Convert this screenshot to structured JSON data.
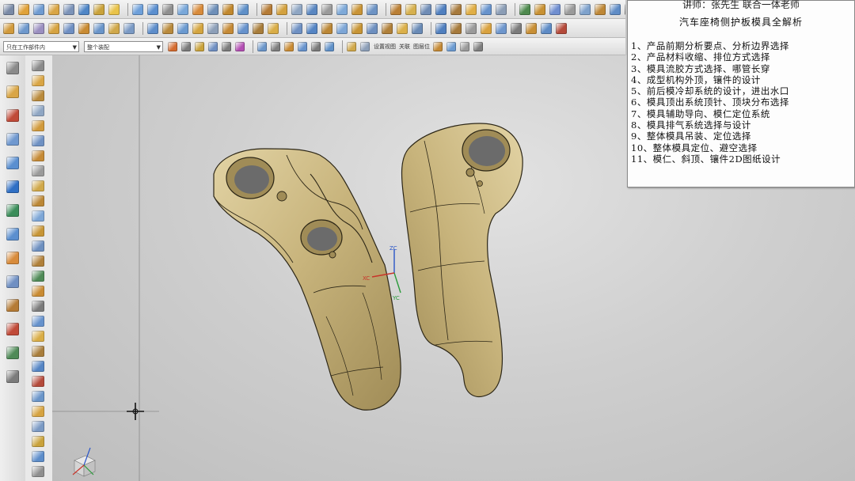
{
  "toolbar": {
    "row1_icon_colors": [
      "#7a8aa6",
      "#e0a23a",
      "#6f9bd1",
      "#d9a545",
      "#7c93b8",
      "#4f86c6",
      "#c9a23b",
      "#e9c34a",
      "#6ea0da",
      "#5b8fcf",
      "#8f8f8f",
      "#79a7d9",
      "#d88b3b",
      "#6e8fb8",
      "#c1882e",
      "#5f90c8",
      "#b57b36",
      "#d3a13f",
      "#8fa6c3",
      "#5a87c1",
      "#9a9a9a",
      "#7ea9d8",
      "#c99437",
      "#6d93c4",
      "#ba7f35",
      "#d6b04e",
      "#6f8cb5",
      "#4f7fbf",
      "#a77a3d",
      "#e0ae45",
      "#6793cc",
      "#8b9db5",
      "#4e8a4e",
      "#c89133",
      "#6f8ed0",
      "#9a9a9a",
      "#7fa2cc",
      "#be8736",
      "#5f8cc6",
      "#7b7b7b",
      "#4f8a57",
      "#6f98cf"
    ],
    "row2_icon_colors": [
      "#d19a3c",
      "#6e98cc",
      "#9b8fc0",
      "#d6a341",
      "#6f8fc2",
      "#c98b33",
      "#6a95c9",
      "#d0a84a",
      "#7b9ac4",
      "#5d8dca",
      "#b98a3c",
      "#6b9ad0",
      "#d4a540",
      "#8d9fb8",
      "#c58a36",
      "#6692cc",
      "#a87d3b",
      "#d9ad47",
      "#6f91c3",
      "#5585c4",
      "#bb8736",
      "#7da6d6",
      "#c79536",
      "#6d8fbf",
      "#b0803a",
      "#dbb04a",
      "#6a8bb6",
      "#507fbe",
      "#a67a3c",
      "#9a9a9a",
      "#d9a23f",
      "#6e96cc",
      "#7b7b7b",
      "#c88f35",
      "#5e8bc5",
      "#b44a3a"
    ],
    "combo1_value": "只在工作部件内",
    "combo2_value": "整个装配",
    "row3_labels": [
      "设置视图",
      "关联",
      "图层位"
    ],
    "row3_icon_colors": [
      "#d46b2f",
      "#7a7a7a",
      "#c9a23b",
      "#6f8fc2",
      "#7b7b7b",
      "#b34fb3",
      "#6a95c9",
      "#7d7d7d",
      "#c98b33",
      "#6692cc",
      "#7a7a7a",
      "#5f90c8",
      "#d0a84a",
      "#8d9fb8",
      "#c58a36",
      "#6b9ad0",
      "#9a9a9a",
      "#7e7e7e"
    ]
  },
  "left_rail": {
    "icon_colors": [
      "#8a8a8a",
      "#d9a545",
      "#c04a38",
      "#6f98cf",
      "#5a8fd0",
      "#2f6fc4",
      "#3b8d5a",
      "#5b8fcf",
      "#d88b3b",
      "#6f8fc2",
      "#b57b36",
      "#c04a38",
      "#4f8a57",
      "#7b7b7b"
    ]
  },
  "left_strip": {
    "icon_colors": [
      "#8a8a8a",
      "#d9a545",
      "#b98a3c",
      "#8fa6c3",
      "#d19a3c",
      "#6f91c3",
      "#c58a36",
      "#9a9a9a",
      "#d0a84a",
      "#bb8736",
      "#7da6d6",
      "#c79536",
      "#6d8fbf",
      "#b0803a",
      "#4f8a57",
      "#c98b33",
      "#7b7b7b",
      "#6692cc",
      "#d9ad47",
      "#a87d3b",
      "#5585c4",
      "#b44a3a",
      "#6a95c9",
      "#d6a341",
      "#7b9ac4",
      "#c9a23b",
      "#5d8dca",
      "#8f8f8f"
    ]
  },
  "panel": {
    "top_line": "讲师：张先生   联合一体老师",
    "title": "汽车座椅侧护板模具全解析",
    "items": [
      "1、产品前期分析要点、分析边界选择",
      "2、产品材料收缩、排位方式选择",
      "3、模具流胶方式选择、哪管长穿",
      "4、成型机构外顶，镶件的设计",
      "5、前后模冷却系统的设计，进出水口",
      "6、模具顶出系统顶针、顶块分布选择",
      "7、模具辅助导向、模仁定位系统",
      "8、模具排气系统选择与设计",
      "9、整体模具吊装、定位选择",
      "10、整体模具定位、避空选择",
      "11、模仁、斜顶、镶件2D图纸设计"
    ]
  },
  "viewport": {
    "part_color": "#c8b47c",
    "part_shade": "#a08c57",
    "part_light": "#e2d3a4",
    "edge_color": "#2c2616",
    "wcs_labels": {
      "zc": "ZC",
      "yc": "YC",
      "xc": "XC"
    }
  }
}
